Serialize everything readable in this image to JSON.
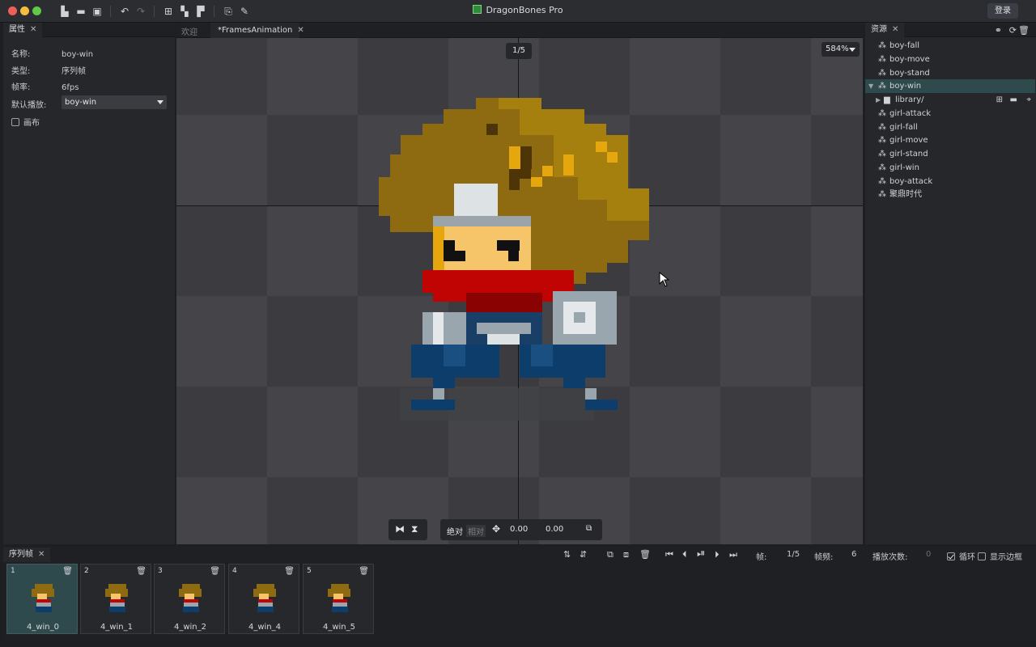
{
  "app": {
    "title": "DragonBones Pro",
    "login": "登录"
  },
  "properties": {
    "tab": "属性",
    "name_label": "名称:",
    "name_value": "boy-win",
    "type_label": "类型:",
    "type_value": "序列帧",
    "fps_label": "帧率:",
    "fps_value": "6fps",
    "default_play_label": "默认播放:",
    "default_play_value": "boy-win",
    "canvas_checkbox": "画布",
    "canvas_checked": false
  },
  "editor_tabs": [
    {
      "label": "欢迎",
      "active": false
    },
    {
      "label": "*FramesAnimation",
      "active": true
    }
  ],
  "canvas": {
    "frame_counter": "1/5",
    "zoom": "584%",
    "toolbox": {
      "absolute": "绝对",
      "relative": "相对",
      "x": "0.00",
      "y": "0.00"
    }
  },
  "resources": {
    "tab": "资源",
    "items": [
      {
        "label": "boy-fall",
        "icon": "animation-icon"
      },
      {
        "label": "boy-move",
        "icon": "animation-icon"
      },
      {
        "label": "boy-stand",
        "icon": "animation-icon"
      },
      {
        "label": "boy-win",
        "icon": "animation-icon",
        "selected": true,
        "expanded": true
      },
      {
        "label": "library/",
        "icon": "folder-icon",
        "child": true
      },
      {
        "label": "girl-attack",
        "icon": "animation-icon"
      },
      {
        "label": "girl-fall",
        "icon": "animation-icon"
      },
      {
        "label": "girl-move",
        "icon": "animation-icon"
      },
      {
        "label": "girl-stand",
        "icon": "animation-icon"
      },
      {
        "label": "girl-win",
        "icon": "animation-icon"
      },
      {
        "label": "boy-attack",
        "icon": "animation-icon"
      },
      {
        "label": "聚鼎时代",
        "icon": "animation-icon"
      }
    ]
  },
  "timeline": {
    "tab": "序列帧",
    "frame_label": "帧:",
    "frame_value": "1/5",
    "rate_label": "帧频:",
    "rate_value": "6",
    "play_count_label": "播放次数:",
    "play_count_value": "0",
    "loop_label": "循环",
    "loop_checked": true,
    "show_border_label": "显示边框",
    "show_border_checked": false,
    "frames": [
      {
        "num": "1",
        "name": "4_win_0",
        "selected": true
      },
      {
        "num": "2",
        "name": "4_win_1"
      },
      {
        "num": "3",
        "name": "4_win_2"
      },
      {
        "num": "4",
        "name": "4_win_4"
      },
      {
        "num": "5",
        "name": "4_win_5"
      }
    ]
  },
  "colors": {
    "accent_selected": "#2f4a4c",
    "hair": "#8a6814",
    "scarf": "#b00000",
    "pants": "#0c3d6b"
  }
}
